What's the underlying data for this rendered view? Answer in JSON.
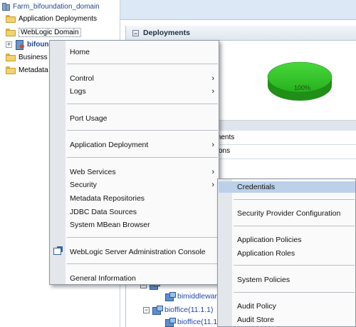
{
  "tree": {
    "farm": "Farm_bifoundation_domain",
    "app_deployments": "Application Deployments",
    "weblogic_domain": "WebLogic Domain",
    "bifoundation": "bifoundation_domain",
    "business": "Business",
    "metadata": "Metadata"
  },
  "panel": {
    "title": "Deployments",
    "pie_label": "100%",
    "row1": "ments",
    "row2": "tions"
  },
  "bottom_tree": {
    "partial": "bimiddlewar",
    "bimiddleware": "bimiddlewar",
    "bioffice": "bioffice(11.1.1)",
    "bioffice2": "bioffice(11.1"
  },
  "context_menu": {
    "home": "Home",
    "control": "Control",
    "logs": "Logs",
    "port_usage": "Port Usage",
    "app_deployment": "Application Deployment",
    "web_services": "Web Services",
    "security": "Security",
    "metadata_repos": "Metadata Repositories",
    "jdbc": "JDBC Data Sources",
    "mbean": "System MBean Browser",
    "wls_console": "WebLogic Server Administration Console",
    "general_info": "General Information",
    "submenu_arrow": "›"
  },
  "security_menu": {
    "credentials": "Credentials",
    "provider_config": "Security Provider Configuration",
    "app_policies": "Application Policies",
    "app_roles": "Application Roles",
    "system_policies": "System Policies",
    "audit_policy": "Audit Policy",
    "audit_store": "Audit Store"
  },
  "colors": {
    "pie": "#33c02a",
    "submenu_hover": "#bcd0ea",
    "link": "#2347a4"
  }
}
